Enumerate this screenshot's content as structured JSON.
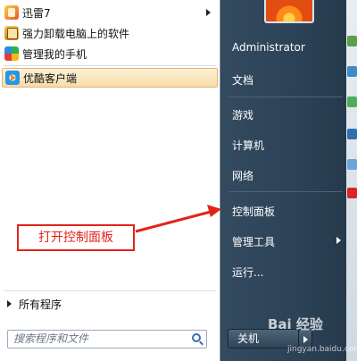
{
  "start_menu": {
    "programs": [
      {
        "label": "迅雷7",
        "icon": "xunlei-icon",
        "has_submenu": true
      },
      {
        "label": "强力卸载电脑上的软件",
        "icon": "uninstall-icon",
        "has_submenu": false
      },
      {
        "label": "管理我的手机",
        "icon": "phone-manager-icon",
        "has_submenu": false
      },
      {
        "label": "优酷客户端",
        "icon": "youku-icon",
        "has_submenu": false,
        "highlighted": true
      }
    ],
    "all_programs": "所有程序",
    "search_placeholder": "搜索程序和文件",
    "right_items": {
      "user": "Administrator",
      "documents": "文档",
      "games": "游戏",
      "computer": "计算机",
      "network": "网络",
      "control_panel": "控制面板",
      "admin_tools": "管理工具",
      "run": "运行..."
    },
    "shutdown": "关机"
  },
  "annotation": {
    "text": "打开控制面板",
    "color": "#e2231a"
  },
  "watermark": {
    "brand": "Bai 经验",
    "url": "jingyan.baidu.com"
  }
}
